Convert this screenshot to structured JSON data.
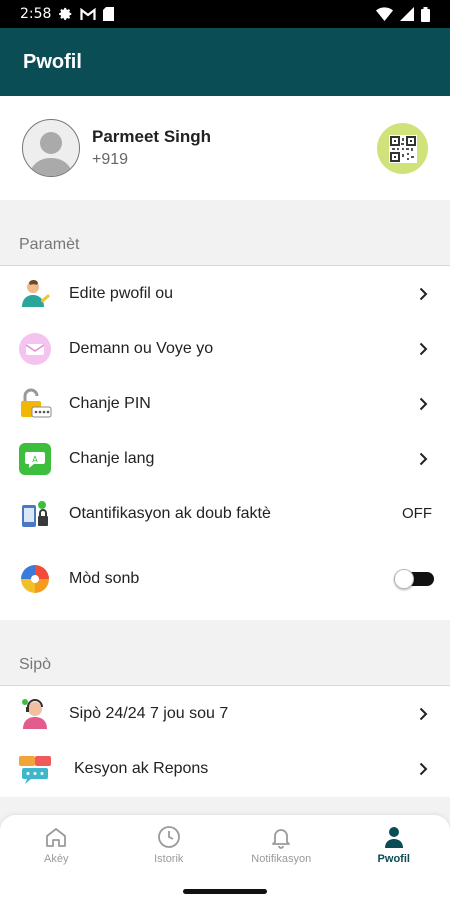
{
  "status_bar": {
    "time": "2:58",
    "icons": [
      "gear-icon",
      "gmail-icon",
      "sd-card-icon"
    ],
    "right_icons": [
      "wifi-icon",
      "signal-icon",
      "battery-icon"
    ]
  },
  "app_bar": {
    "title": "Pwofil"
  },
  "profile": {
    "name": "Parmeet Singh",
    "phone": "+919",
    "avatar_icon": "avatar-placeholder-icon",
    "qr_icon": "qr-code-icon"
  },
  "settings": {
    "section_title": "Paramèt",
    "items": [
      {
        "label": "Edite pwofil ou",
        "icon": "edit-profile-icon",
        "action": "chevron"
      },
      {
        "label": "Demann ou Voye yo",
        "icon": "requests-icon",
        "action": "chevron"
      },
      {
        "label": "Chanje PIN",
        "icon": "pin-lock-icon",
        "action": "chevron"
      },
      {
        "label": "Chanje lang",
        "icon": "language-icon",
        "action": "chevron"
      },
      {
        "label": "Otantifikasyon ak doub faktè",
        "icon": "two-factor-icon",
        "value": "OFF"
      },
      {
        "label": "Mòd sonb",
        "icon": "dark-mode-icon",
        "toggle": false
      }
    ]
  },
  "support": {
    "section_title": "Sipò",
    "items": [
      {
        "label": "Sipò 24/24 7 jou sou 7",
        "icon": "support-agent-icon",
        "action": "chevron"
      },
      {
        "label": "Kesyon ak Repons",
        "icon": "faq-icon",
        "action": "chevron"
      }
    ]
  },
  "bottom_nav": {
    "items": [
      {
        "label": "Akèy",
        "icon": "home-icon",
        "active": false
      },
      {
        "label": "Istorik",
        "icon": "history-icon",
        "active": false
      },
      {
        "label": "Notifikasyon",
        "icon": "bell-icon",
        "active": false
      },
      {
        "label": "Pwofil",
        "icon": "profile-icon",
        "active": true
      }
    ]
  },
  "colors": {
    "app_bar": "#0b4d54",
    "qr_bg": "#cfe37a",
    "active_nav": "#0b4d54"
  }
}
